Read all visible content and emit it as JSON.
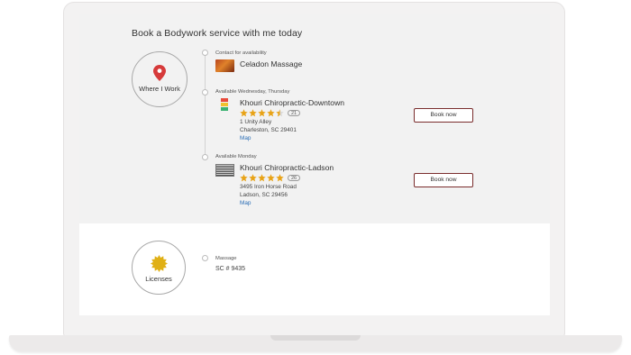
{
  "heading": "Book a Bodywork service with me today",
  "where_i_work": {
    "badge_label": "Where I Work",
    "locations": [
      {
        "availability": "Contact for availability",
        "name": "Celadon Massage"
      },
      {
        "availability": "Available Wednesday, Thursday",
        "name": "Khouri Chiropractic-Downtown",
        "rating": 4.5,
        "review_count": "21",
        "address_line1": "1 Unity Alley",
        "address_line2": "Charleston, SC 29401",
        "map_label": "Map",
        "book_label": "Book now"
      },
      {
        "availability": "Available Monday",
        "name": "Khouri Chiropractic-Ladson",
        "rating": 5,
        "review_count": "26",
        "address_line1": "3495 Iron Horse Road",
        "address_line2": "Ladson, SC 29456",
        "map_label": "Map",
        "book_label": "Book now"
      }
    ]
  },
  "licenses": {
    "badge_label": "Licenses",
    "type": "Massage",
    "number": "SC # 9435"
  },
  "colors": {
    "star": "#e8a317",
    "pin": "#d63a3a",
    "button_border": "#7a2d2d",
    "link": "#2a6db5",
    "seal": "#e0b015"
  }
}
